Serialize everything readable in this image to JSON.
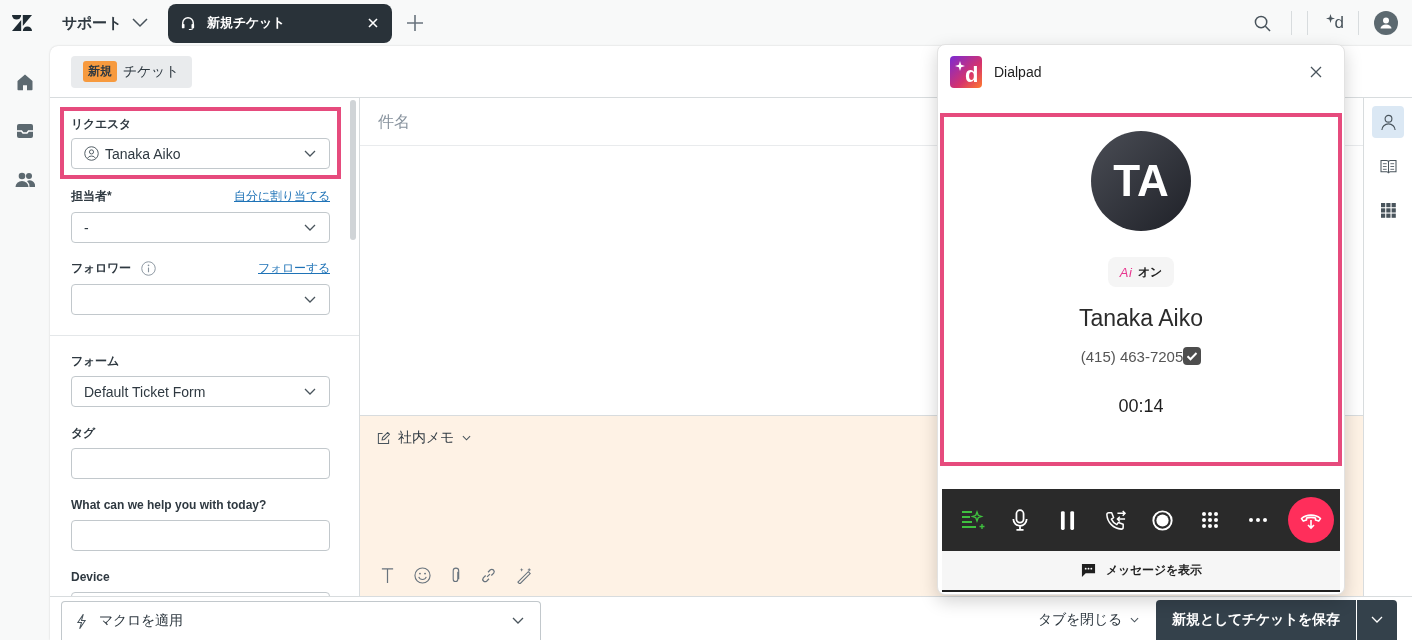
{
  "top_bar": {
    "product_menu": "サポート",
    "tabs": [
      {
        "label": "新規チケット",
        "selected": true
      }
    ],
    "dialpad_button": {
      "mark": "d"
    }
  },
  "ticket_header": {
    "status_badge": "新規",
    "title": "チケット"
  },
  "requester": {
    "label": "リクエスタ",
    "value": "Tanaka Aiko",
    "highlighted": true
  },
  "assignee": {
    "label": "担当者*",
    "value": "-",
    "link": "自分に割り当てる"
  },
  "followers": {
    "label": "フォロワー",
    "info": true,
    "link": "フォローする"
  },
  "ticket_fields": [
    {
      "kind": "select",
      "label": "フォーム",
      "value": "Default Ticket Form"
    },
    {
      "kind": "text",
      "label": "タグ"
    },
    {
      "kind": "text",
      "label": "What can we help you with today?"
    },
    {
      "kind": "text",
      "label": "Device"
    }
  ],
  "subject": {
    "placeholder": "件名"
  },
  "comment": {
    "mode": "社内メモ"
  },
  "bottom_bar": {
    "macro_menu": "マクロを適用",
    "close_tab": "タブを閉じる",
    "submit": "新規としてチケットを保存"
  },
  "apps_rail": [
    {
      "kind": "customer",
      "selected": true
    },
    {
      "kind": "knowledge",
      "selected": false
    },
    {
      "kind": "apps",
      "selected": false
    }
  ],
  "dialpad": {
    "logo_mark": "d",
    "title": "Dialpad",
    "caller": {
      "highlighted": true,
      "initials": "TA",
      "ai_logo": "Ai",
      "ai_status": "オン",
      "name": "Tanaka Aiko",
      "phone": "(415) 463-7205",
      "verified": true,
      "timer": "00:14"
    },
    "controls": [
      {
        "kind": "ai_notes",
        "active": true
      },
      {
        "kind": "mute",
        "active": false
      },
      {
        "kind": "hold",
        "active": false
      },
      {
        "kind": "transfer",
        "active": false
      },
      {
        "kind": "record",
        "active": false
      },
      {
        "kind": "keypad",
        "active": false
      },
      {
        "kind": "more",
        "active": false
      },
      {
        "kind": "hangup",
        "active": false
      }
    ],
    "messages_link": "メッセージを表示"
  }
}
